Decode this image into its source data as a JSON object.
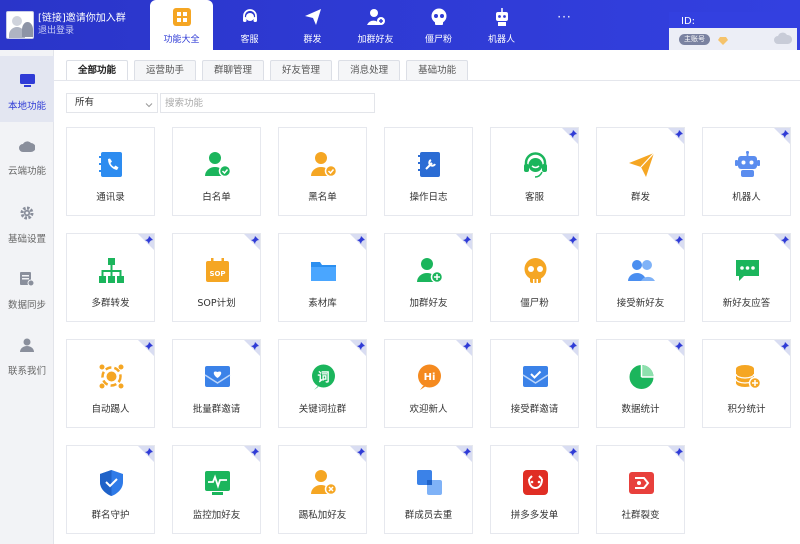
{
  "account": {
    "title": "[链接]邀请你加入群",
    "logout": "退出登录"
  },
  "nav": [
    {
      "label": "功能大全",
      "icon": "grid-icon",
      "active": true
    },
    {
      "label": "客服",
      "icon": "headset-icon"
    },
    {
      "label": "群发",
      "icon": "paper-plane-icon"
    },
    {
      "label": "加群好友",
      "icon": "add-friend-icon"
    },
    {
      "label": "僵尸粉",
      "icon": "skull-icon"
    },
    {
      "label": "机器人",
      "icon": "robot-icon"
    },
    {
      "label": "···",
      "icon": "more-icon"
    }
  ],
  "idbox": {
    "id_label": "ID:",
    "badge": "主账号"
  },
  "sidebar": [
    {
      "label": "本地功能",
      "icon": "monitor-icon",
      "active": true
    },
    {
      "label": "云端功能",
      "icon": "cloud-icon"
    },
    {
      "label": "基础设置",
      "icon": "gear-icon"
    },
    {
      "label": "数据同步",
      "icon": "sync-icon"
    },
    {
      "label": "联系我们",
      "icon": "person-icon"
    }
  ],
  "subtabs": [
    "全部功能",
    "运营助手",
    "群聊管理",
    "好友管理",
    "消息处理",
    "基础功能"
  ],
  "filter": {
    "value": "所有"
  },
  "search": {
    "placeholder": "搜索功能"
  },
  "cards": [
    {
      "label": "通讯录",
      "icon": "contacts-icon",
      "pinned": false
    },
    {
      "label": "白名单",
      "icon": "whitelist-icon",
      "pinned": false
    },
    {
      "label": "黑名单",
      "icon": "blacklist-icon",
      "pinned": false
    },
    {
      "label": "操作日志",
      "icon": "log-icon",
      "pinned": false
    },
    {
      "label": "客服",
      "icon": "headset-icon",
      "pinned": true
    },
    {
      "label": "群发",
      "icon": "paper-plane-icon",
      "pinned": true
    },
    {
      "label": "机器人",
      "icon": "robot-icon",
      "pinned": true
    },
    {
      "label": "多群转发",
      "icon": "tree-icon",
      "pinned": true
    },
    {
      "label": "SOP计划",
      "icon": "calendar-icon",
      "pinned": true
    },
    {
      "label": "素材库",
      "icon": "folder-icon",
      "pinned": true
    },
    {
      "label": "加群好友",
      "icon": "add-friend-icon",
      "pinned": true
    },
    {
      "label": "僵尸粉",
      "icon": "skull-icon",
      "pinned": true
    },
    {
      "label": "接受新好友",
      "icon": "friends-icon",
      "pinned": true
    },
    {
      "label": "新好友应答",
      "icon": "chat-icon",
      "pinned": true
    },
    {
      "label": "自动踢人",
      "icon": "kick-icon",
      "pinned": true
    },
    {
      "label": "批量群邀请",
      "icon": "envelope-heart-icon",
      "pinned": true
    },
    {
      "label": "关键词拉群",
      "icon": "keyword-icon",
      "pinned": true
    },
    {
      "label": "欢迎新人",
      "icon": "hi-icon",
      "pinned": true
    },
    {
      "label": "接受群邀请",
      "icon": "envelope-check-icon",
      "pinned": true
    },
    {
      "label": "数据统计",
      "icon": "pie-icon",
      "pinned": true
    },
    {
      "label": "积分统计",
      "icon": "coins-icon",
      "pinned": true
    },
    {
      "label": "群名守护",
      "icon": "shield-icon",
      "pinned": true
    },
    {
      "label": "监控加好友",
      "icon": "monitor-pulse-icon",
      "pinned": true
    },
    {
      "label": "踢私加好友",
      "icon": "user-x-icon",
      "pinned": true
    },
    {
      "label": "群成员去重",
      "icon": "dedupe-icon",
      "pinned": true
    },
    {
      "label": "拼多多发单",
      "icon": "pdd-icon",
      "pinned": true
    },
    {
      "label": "社群裂变",
      "icon": "fission-icon",
      "pinned": true
    }
  ],
  "colors": {
    "brand": "#2f3bd6",
    "blue": "#2d8cf0",
    "green": "#1bb55c",
    "orange": "#f5a623"
  }
}
